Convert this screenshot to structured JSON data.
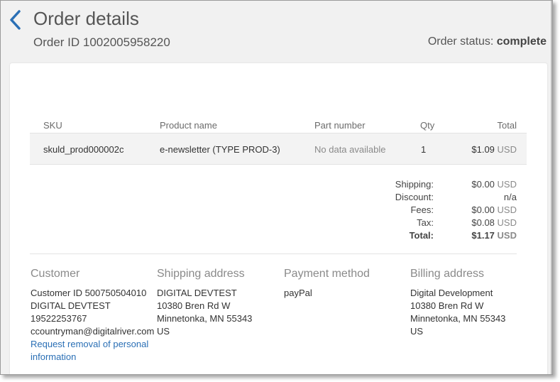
{
  "header": {
    "title": "Order details",
    "order_id": "Order ID 1002005958220",
    "status_label": "Order status:",
    "status_value": "complete"
  },
  "table": {
    "columns": [
      "SKU",
      "Product name",
      "Part number",
      "Qty",
      "Total"
    ],
    "rows": [
      {
        "sku": "skuld_prod000002c",
        "product": "e-newsletter (TYPE PROD-3)",
        "part_number": "No data available",
        "qty": "1",
        "total": "$1.09",
        "currency": "USD"
      }
    ]
  },
  "summary": {
    "shipping_label": "Shipping:",
    "shipping_value": "$0.00",
    "shipping_currency": "USD",
    "discount_label": "Discount:",
    "discount_value": "n/a",
    "fees_label": "Fees:",
    "fees_value": "$0.00",
    "fees_currency": "USD",
    "tax_label": "Tax:",
    "tax_value": "$0.08",
    "tax_currency": "USD",
    "total_label": "Total:",
    "total_value": "$1.17",
    "total_currency": "USD"
  },
  "customer": {
    "title": "Customer",
    "customer_id": "Customer ID 500750504010",
    "name": "DIGITAL DEVTEST",
    "phone": "19522253767",
    "email": "ccountryman@digitalriver.com",
    "removal_link_1": "Request removal of personal",
    "removal_link_2": "information"
  },
  "shipping_address": {
    "title": "Shipping address",
    "name": "DIGITAL DEVTEST",
    "street": "10380 Bren Rd W",
    "city": "Minnetonka, MN 55343",
    "country": "US"
  },
  "payment": {
    "title": "Payment method",
    "method": "payPal"
  },
  "billing_address": {
    "title": "Billing address",
    "name": "Digital Development",
    "street": "10380 Bren Rd W",
    "city": "Minnetonka, MN 55343",
    "country": "US"
  },
  "icons": {
    "back": "chevron-left-icon"
  },
  "colors": {
    "accent": "#2a6fb5",
    "background": "#f1f1f1",
    "card": "#ffffff"
  }
}
